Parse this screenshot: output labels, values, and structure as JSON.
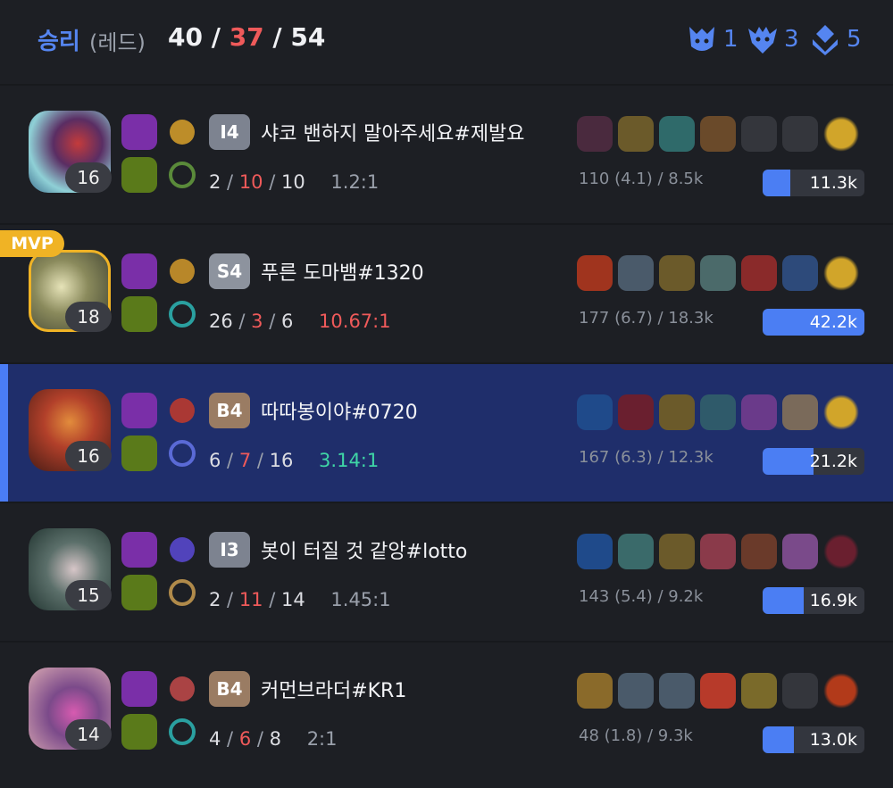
{
  "header": {
    "result": "승리",
    "team": "(레드)",
    "kills": "40",
    "deaths": "37",
    "assists": "54",
    "objectives": [
      {
        "icon": "baron-icon",
        "count": "1"
      },
      {
        "icon": "dragon-icon",
        "count": "3"
      },
      {
        "icon": "tower-icon",
        "count": "5"
      }
    ]
  },
  "colors": {
    "accent": "#5585f0",
    "red": "#ef5a5a",
    "green": "#3fd6a6",
    "mvp": "#f0b325",
    "highlight": "#1f2e6b"
  },
  "players": [
    {
      "level": "16",
      "tier": "I4",
      "tier_color": "#7d8390",
      "name": "샤코 밴하지 말아주세요#제발요",
      "kills": "2",
      "deaths": "10",
      "assists": "10",
      "ratio": "1.2:1",
      "ratio_style": "gray",
      "cs": "110 (4.1) / 8.5k",
      "damage": "11.3k",
      "damage_fraction": 0.27,
      "mvp": false,
      "highlight": false,
      "champion": "ranged-champion",
      "spells": [
        "flash",
        "ghost"
      ],
      "runes": [
        "electrocute",
        "resolve-secondary"
      ],
      "items": [
        "dagger",
        "boots",
        "shield",
        "cleaver",
        "empty",
        "empty",
        "ward"
      ]
    },
    {
      "level": "18",
      "tier": "S4",
      "tier_color": "#8d939e",
      "name": "푸른 도마뱀#1320",
      "kills": "26",
      "deaths": "3",
      "assists": "6",
      "ratio": "10.67:1",
      "ratio_style": "red",
      "cs": "177 (6.7) / 18.3k",
      "damage": "42.2k",
      "damage_fraction": 1.0,
      "mvp": true,
      "highlight": false,
      "champion": "gunner-champion",
      "spells": [
        "flash",
        "ghost"
      ],
      "runes": [
        "conqueror",
        "sorcery-secondary"
      ],
      "items": [
        "sword",
        "armor",
        "boots",
        "cannon",
        "blade",
        "bow",
        "ward"
      ]
    },
    {
      "level": "16",
      "tier": "B4",
      "tier_color": "#9a7c63",
      "name": "따따봉이야#0720",
      "kills": "6",
      "deaths": "7",
      "assists": "16",
      "ratio": "3.14:1",
      "ratio_style": "green",
      "cs": "167 (6.3) / 12.3k",
      "damage": "21.2k",
      "damage_fraction": 0.5,
      "mvp": false,
      "highlight": true,
      "champion": "fire-champion",
      "spells": [
        "flash",
        "ghost"
      ],
      "runes": [
        "domination",
        "inspiration-secondary"
      ],
      "items": [
        "ring",
        "orb",
        "boots",
        "staff",
        "crystal",
        "rock",
        "ward"
      ]
    },
    {
      "level": "15",
      "tier": "I3",
      "tier_color": "#7d8390",
      "name": "봇이 터질 것 같앙#lotto",
      "kills": "2",
      "deaths": "11",
      "assists": "14",
      "ratio": "1.45:1",
      "ratio_style": "gray",
      "cs": "143 (5.4) / 9.2k",
      "damage": "16.9k",
      "damage_fraction": 0.4,
      "mvp": false,
      "highlight": false,
      "champion": "mage-champion",
      "spells": [
        "flash",
        "ghost"
      ],
      "runes": [
        "arcane-comet",
        "domination-secondary"
      ],
      "items": [
        "ring",
        "wand",
        "boots",
        "heart",
        "tome",
        "sigil",
        "orb"
      ]
    },
    {
      "level": "14",
      "tier": "B4",
      "tier_color": "#9a7c63",
      "name": "커먼브라더#KR1",
      "kills": "4",
      "deaths": "6",
      "assists": "8",
      "ratio": "2:1",
      "ratio_style": "gray",
      "cs": "48 (1.8) / 9.3k",
      "damage": "13.0k",
      "damage_fraction": 0.31,
      "mvp": false,
      "highlight": false,
      "champion": "support-champion",
      "spells": [
        "flash",
        "ghost"
      ],
      "runes": [
        "aery",
        "sorcery-secondary"
      ],
      "items": [
        "relic",
        "hook",
        "armor",
        "gem",
        "mace",
        "empty",
        "lens"
      ]
    }
  ]
}
